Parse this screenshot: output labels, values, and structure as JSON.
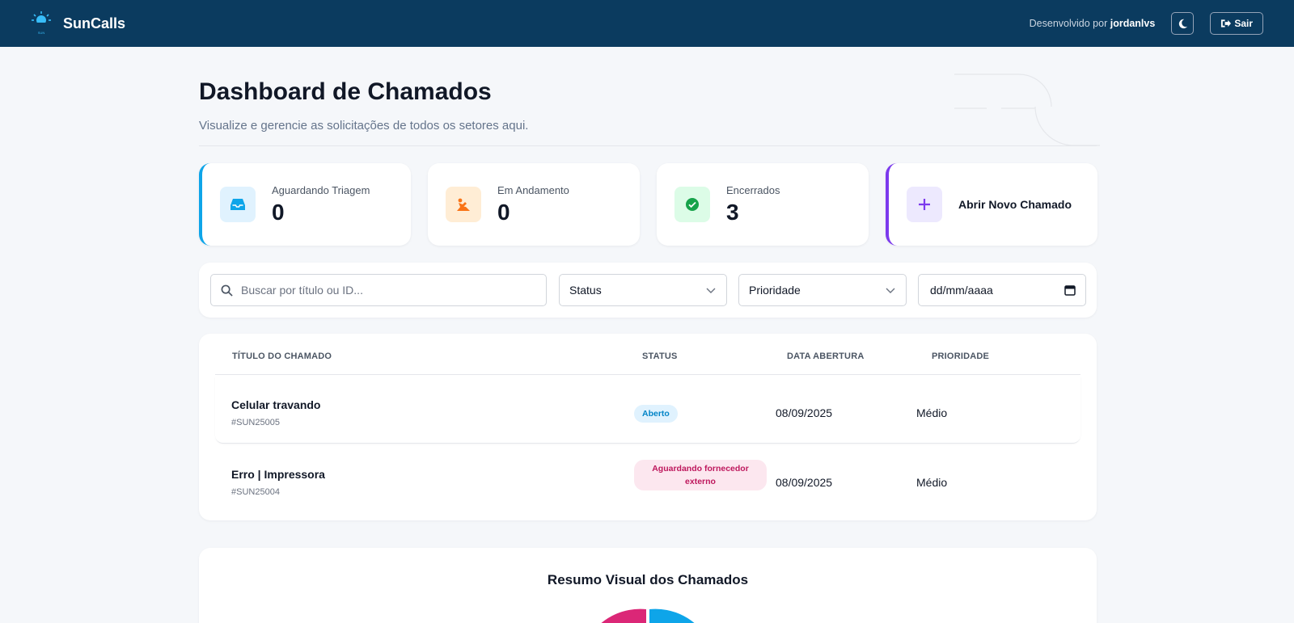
{
  "header": {
    "brand": "SunCalls",
    "dev_prefix": "Desenvolvido por",
    "dev_name": "jordanlvs",
    "theme_icon": "moon-icon",
    "logout_label": "Sair",
    "bg_color": "#0b3b5f"
  },
  "page": {
    "title": "Dashboard de Chamados",
    "subtitle": "Visualize e gerencie as solicitações de todos os setores aqui."
  },
  "stats": [
    {
      "label": "Aguardando Triagem",
      "value": "0",
      "icon": "inbox-icon",
      "color": "#0ea5e9"
    },
    {
      "label": "Em Andamento",
      "value": "0",
      "icon": "worker-icon",
      "color": "#f97316"
    },
    {
      "label": "Encerrados",
      "value": "3",
      "icon": "check-circle-icon",
      "color": "#16a34a"
    }
  ],
  "new_ticket": {
    "label": "Abrir Novo Chamado",
    "icon": "plus-icon",
    "color": "#7c3aed"
  },
  "filters": {
    "search_placeholder": "Buscar por título ou ID...",
    "status_label": "Status",
    "priority_label": "Prioridade",
    "date_placeholder": "dd/mm/aaaa"
  },
  "table": {
    "columns": [
      "TÍTULO DO CHAMADO",
      "STATUS",
      "DATA ABERTURA",
      "PRIORIDADE"
    ],
    "rows": [
      {
        "title": "Celular travando",
        "id": "#SUN25005",
        "status": "Aberto",
        "date": "08/09/2025",
        "priority": "Médio"
      },
      {
        "title": "Erro | Impressora",
        "id": "#SUN25004",
        "status": "Aguardando fornecedor externo",
        "date": "08/09/2025",
        "priority": "Médio"
      }
    ]
  },
  "summary": {
    "title": "Resumo Visual dos Chamados"
  }
}
